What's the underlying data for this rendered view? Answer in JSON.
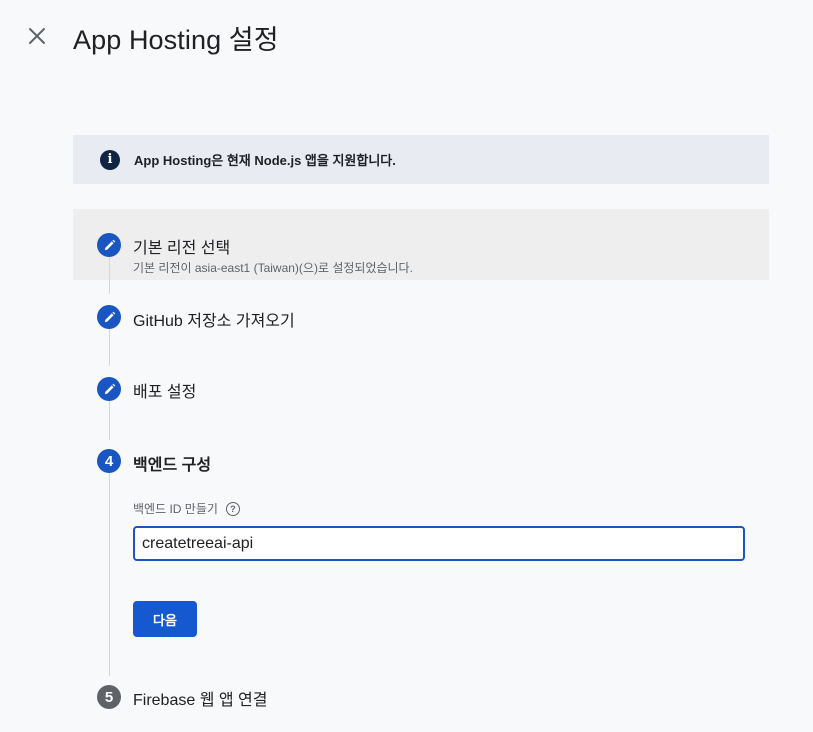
{
  "header": {
    "title": "App Hosting 설정",
    "close_icon": "close-icon"
  },
  "banner": {
    "icon": "info-icon",
    "icon_glyph": "i",
    "text": "App Hosting은 현재 Node.js 앱을 지원합니다."
  },
  "steps": [
    {
      "status": "done",
      "icon": "pencil-icon",
      "title": "기본 리전 선택",
      "subtitle": "기본 리전이 asia-east1 (Taiwan)(으)로 설정되었습니다."
    },
    {
      "status": "done",
      "icon": "pencil-icon",
      "title": "GitHub 저장소 가져오기"
    },
    {
      "status": "done",
      "icon": "pencil-icon",
      "title": "배포 설정"
    },
    {
      "status": "active",
      "number": "4",
      "title": "백엔드 구성"
    },
    {
      "status": "pending",
      "number": "5",
      "title": "Firebase 웹 앱 연결"
    }
  ],
  "form": {
    "backend_id_label": "백엔드 ID 만들기",
    "help_icon": "help-icon",
    "help_glyph": "?",
    "backend_id_value": "createtreeai-api",
    "next_button": "다음"
  },
  "colors": {
    "accent": "#1a56c2",
    "banner_bg": "#e8ecf2",
    "pending_step": "#5f6368"
  }
}
